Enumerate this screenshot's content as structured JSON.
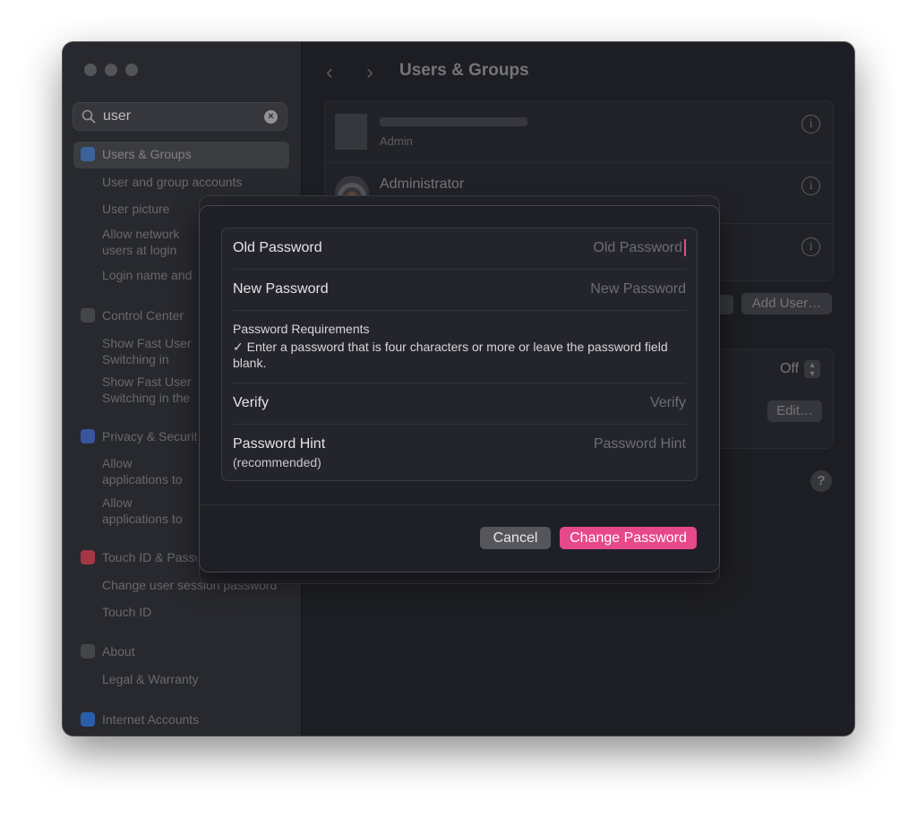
{
  "search": {
    "value": "user"
  },
  "sidebar": {
    "selected": "Users & Groups",
    "items": [
      {
        "kind": "cat",
        "label": "Users & Groups",
        "top": 0
      },
      {
        "kind": "sub",
        "label": "User and group accounts"
      },
      {
        "kind": "sub",
        "label": "User picture"
      },
      {
        "kind": "sub",
        "label": "Allow network users at login window"
      },
      {
        "kind": "sub",
        "label": "Login name and"
      },
      {
        "kind": "cat",
        "label": "Control Center"
      },
      {
        "kind": "sub",
        "label": "Show Fast User Switching in Control Center"
      },
      {
        "kind": "sub",
        "label": "Show Fast User Switching in the menu bar"
      },
      {
        "kind": "cat",
        "label": "Privacy & Security"
      },
      {
        "kind": "sub",
        "label": "Allow applications to access user files"
      },
      {
        "kind": "sub",
        "label": "Allow applications to access user files"
      },
      {
        "kind": "cat",
        "label": "Touch ID & Password"
      },
      {
        "kind": "sub",
        "label": "Change user session password"
      },
      {
        "kind": "sub",
        "label": "Touch ID"
      },
      {
        "kind": "cat",
        "label": "About"
      },
      {
        "kind": "sub",
        "label": "Legal & Warranty"
      },
      {
        "kind": "cat",
        "label": "Internet Accounts"
      }
    ]
  },
  "main": {
    "title": "Users & Groups",
    "users": [
      {
        "name": "",
        "role": "Admin"
      },
      {
        "name": "Administrator",
        "role": ""
      },
      {
        "name": "",
        "role": ""
      }
    ],
    "add_user_label": "Add User…",
    "auto_login_value": "Off",
    "edit_label": "Edit…",
    "help_label": "?"
  },
  "sheet": {
    "old_password": {
      "label": "Old Password",
      "placeholder": "Old Password"
    },
    "new_password": {
      "label": "New Password",
      "placeholder": "New Password"
    },
    "requirements_title": "Password Requirements",
    "requirements_text": "✓ Enter a password that is four characters or more or leave the password field blank.",
    "verify": {
      "label": "Verify",
      "placeholder": "Verify"
    },
    "hint": {
      "label": "Password Hint",
      "sublabel": "(recommended)",
      "placeholder": "Password Hint"
    },
    "cancel_label": "Cancel",
    "confirm_label": "Change Password"
  },
  "colors": {
    "accent": "#e6488a",
    "window_bg": "#1e1f25",
    "sidebar_bg": "#2b2c31"
  }
}
